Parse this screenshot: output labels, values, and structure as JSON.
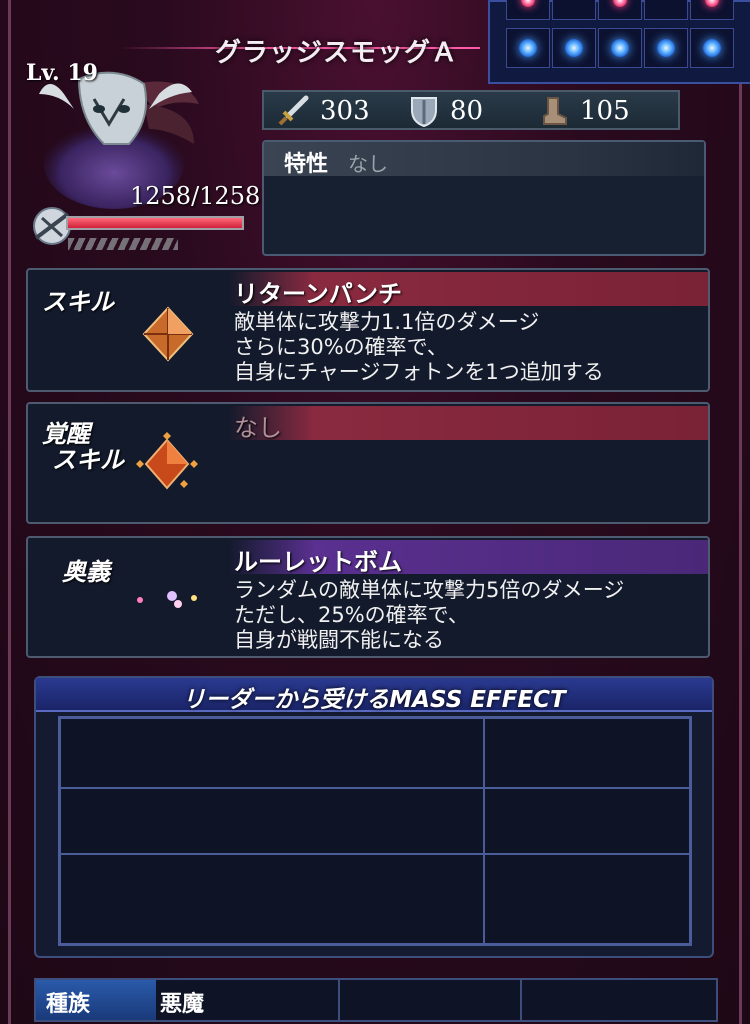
{
  "unit": {
    "name": "グラッジスモッグＡ",
    "level": "Lv. 19",
    "hp": "1258/1258",
    "hp_fraction": 1.0
  },
  "stats": {
    "attack": "303",
    "defense": "80",
    "speed": "105"
  },
  "trait": {
    "label": "特性",
    "value": "なし"
  },
  "skill": {
    "label": "スキル",
    "name": "リターンパンチ",
    "description": "敵単体に攻撃力1.1倍のダメージ\nさらに30%の確率で、\n自身にチャージフォトンを1つ追加する"
  },
  "awakening": {
    "label_line1": "覚醒",
    "label_line2": "スキル",
    "name": "なし"
  },
  "ougi": {
    "label": "奥義",
    "name": "ルーレットボム",
    "description": "ランダムの敵単体に攻撃力5倍のダメージ\nただし、25%の確率で、\n自身が戦闘不能になる"
  },
  "mass_effect": {
    "title": "リーダーから受けるMASS EFFECT"
  },
  "race": {
    "label": "種族",
    "value": "悪魔"
  },
  "icons": [
    "sword-icon",
    "shield-icon",
    "boot-icon",
    "hp-icon",
    "skill-gem-icon",
    "awakening-gem-icon",
    "ougi-moon-icon"
  ],
  "colors": {
    "background": "#2a0a1e",
    "skill_header": "#8a2a40",
    "ougi_header": "#5a3090",
    "mass_header": "#2a3a90",
    "orb_blue": "#5ab0ff"
  }
}
